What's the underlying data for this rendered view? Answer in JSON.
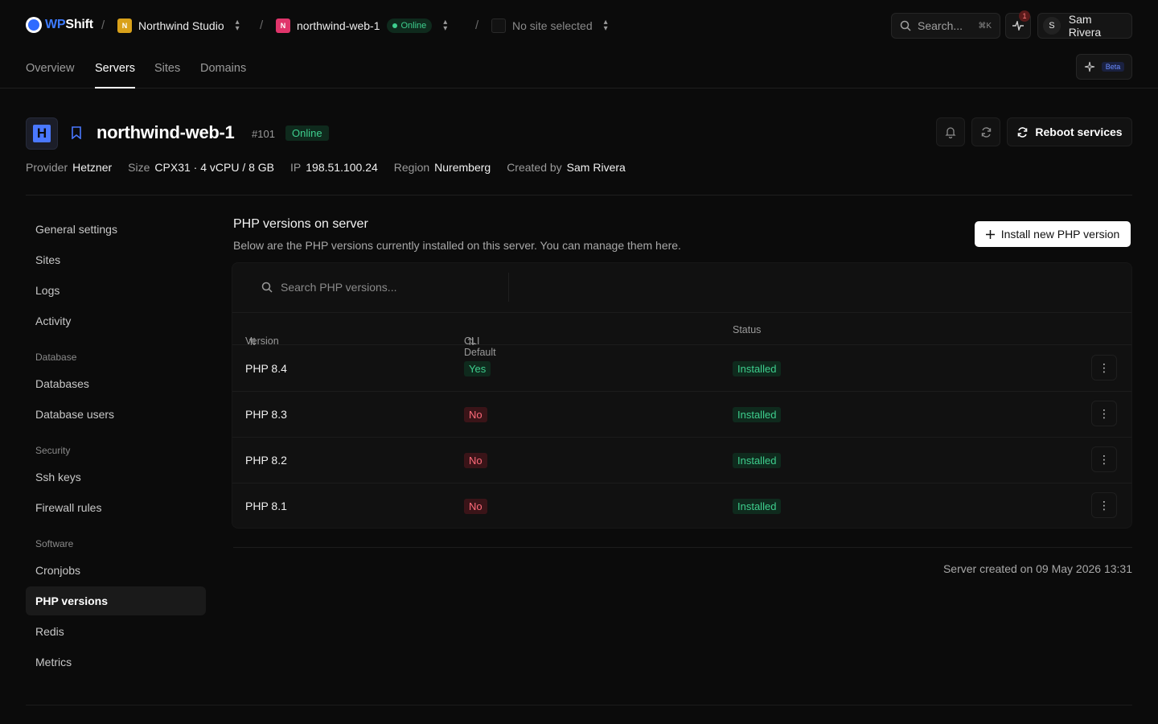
{
  "brand": {
    "wp": "WP",
    "shift": "Shift"
  },
  "breadcrumb": {
    "org": {
      "initial": "N",
      "name": "Northwind Studio",
      "color": "#e0a419"
    },
    "server": {
      "initial": "N",
      "name": "northwind-web-1",
      "status": "Online",
      "color": "#e0356b"
    },
    "site": {
      "name": "No site selected"
    }
  },
  "topbar": {
    "search_label": "Search...",
    "search_shortcut": "⌘K",
    "notification_count": "1",
    "user_initial": "S",
    "user_name": "Sam Rivera"
  },
  "tabs": [
    "Overview",
    "Servers",
    "Sites",
    "Domains"
  ],
  "active_tab": "Servers",
  "beta_label": "Beta",
  "server": {
    "name": "northwind-web-1",
    "id": "#101",
    "status": "Online",
    "reboot_label": "Reboot services",
    "meta": [
      {
        "key": "Provider",
        "value": "Hetzner"
      },
      {
        "key": "Size",
        "value": "CPX31 · 4 vCPU / 8 GB"
      },
      {
        "key": "IP",
        "value": "198.51.100.24"
      },
      {
        "key": "Region",
        "value": "Nuremberg"
      },
      {
        "key": "Created by",
        "value": "Sam Rivera"
      }
    ]
  },
  "sidebar": {
    "items_top": [
      "General settings",
      "Sites",
      "Logs",
      "Activity"
    ],
    "groups": [
      {
        "label": "Database",
        "items": [
          "Databases",
          "Database users"
        ]
      },
      {
        "label": "Security",
        "items": [
          "Ssh keys",
          "Firewall rules"
        ]
      },
      {
        "label": "Software",
        "items": [
          "Cronjobs",
          "PHP versions",
          "Redis",
          "Metrics"
        ]
      }
    ],
    "active": "PHP versions"
  },
  "php": {
    "title": "PHP versions on server",
    "description": "Below are the PHP versions currently installed on this server. You can manage them here.",
    "install_label": "Install new PHP version",
    "search_placeholder": "Search PHP versions...",
    "columns": [
      "Version",
      "CLI Default",
      "Status"
    ],
    "rows": [
      {
        "version": "PHP 8.4",
        "cli_default": "Yes",
        "status": "Installed"
      },
      {
        "version": "PHP 8.3",
        "cli_default": "No",
        "status": "Installed"
      },
      {
        "version": "PHP 8.2",
        "cli_default": "No",
        "status": "Installed"
      },
      {
        "version": "PHP 8.1",
        "cli_default": "No",
        "status": "Installed"
      }
    ]
  },
  "footer_note": "Server created on 09 May 2026 13:31"
}
